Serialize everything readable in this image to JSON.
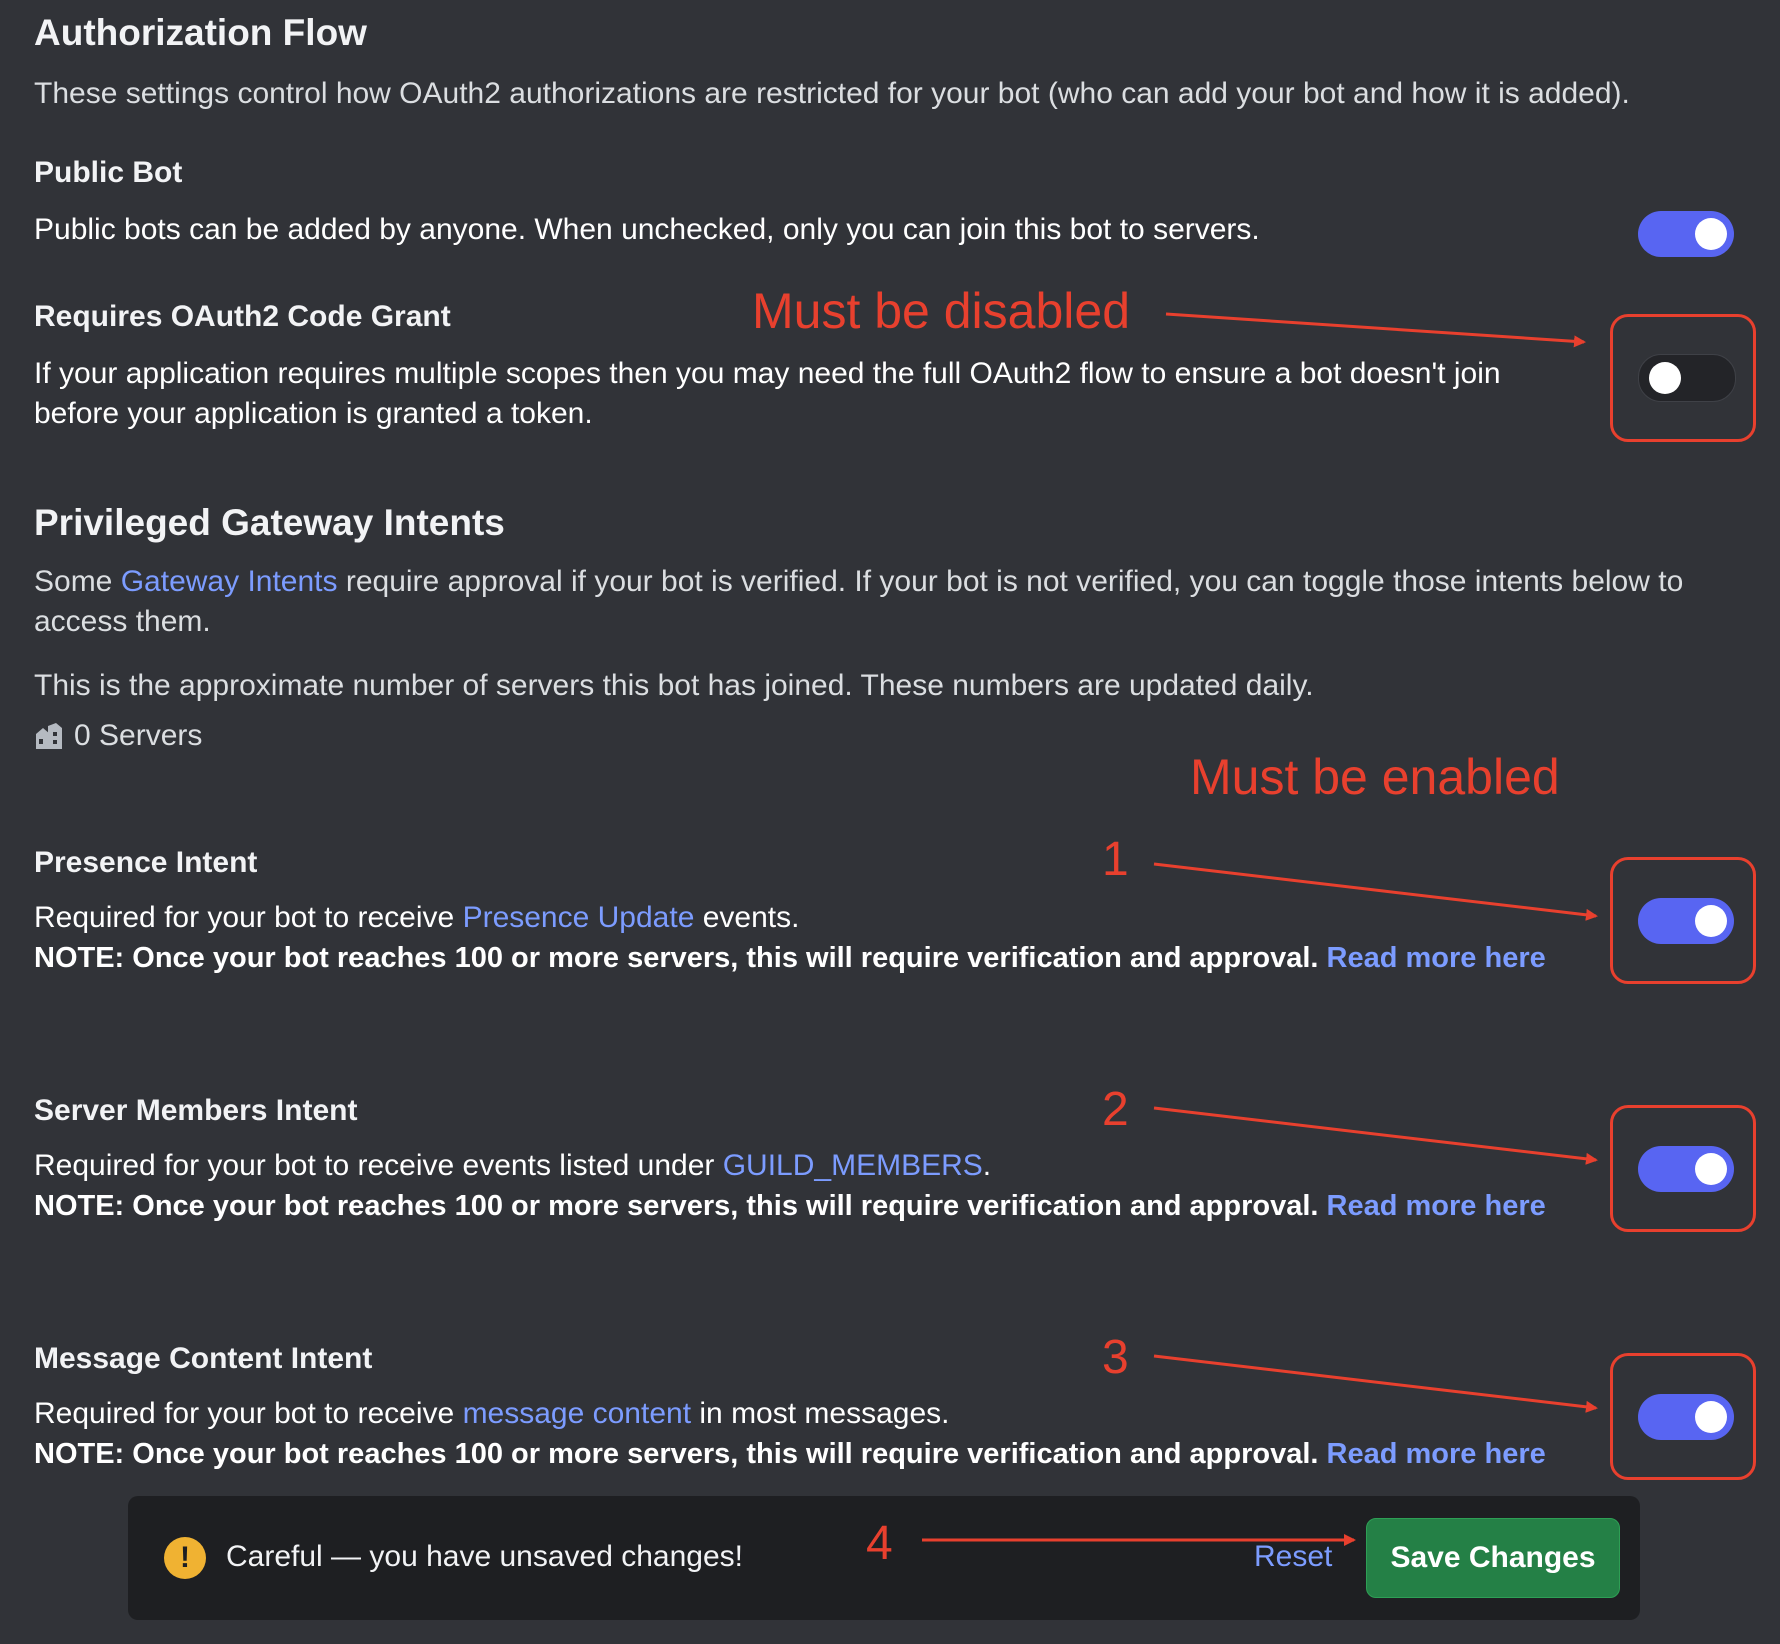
{
  "auth_flow": {
    "title": "Authorization Flow",
    "description": "These settings control how OAuth2 authorizations are restricted for your bot (who can add your bot and how it is added)."
  },
  "public_bot": {
    "label": "Public Bot",
    "description": "Public bots can be added by anyone. When unchecked, only you can join this bot to servers.",
    "enabled": true
  },
  "code_grant": {
    "label": "Requires OAuth2 Code Grant",
    "description_line1": "If your application requires multiple scopes then you may need the full OAuth2 flow to ensure a bot doesn't join",
    "description_line2": "before your application is granted a token.",
    "enabled": false
  },
  "intents": {
    "title": "Privileged Gateway Intents",
    "desc_prefix": "Some ",
    "desc_link": "Gateway Intents",
    "desc_suffix": " require approval if your bot is verified. If your bot is not verified, you can toggle those intents below to",
    "desc_line2": "access them.",
    "servers_note": "This is the approximate number of servers this bot has joined. These numbers are updated daily.",
    "servers_count": "0 Servers",
    "servers_icon": "building-icon"
  },
  "presence": {
    "label": "Presence Intent",
    "text_prefix": "Required for your bot to receive ",
    "text_link": "Presence Update",
    "text_suffix": " events.",
    "note": "NOTE: Once your bot reaches 100 or more servers, this will require verification and approval. ",
    "note_link": "Read more here",
    "enabled": true
  },
  "members": {
    "label": "Server Members Intent",
    "text_prefix": "Required for your bot to receive events listed under ",
    "text_link": "GUILD_MEMBERS",
    "text_suffix": ".",
    "note": "NOTE: Once your bot reaches 100 or more servers, this will require verification and approval. ",
    "note_link": "Read more here",
    "enabled": true
  },
  "message_content": {
    "label": "Message Content Intent",
    "text_prefix": "Required for your bot to receive ",
    "text_link": "message content",
    "text_suffix": " in most messages.",
    "note": "NOTE: Once your bot reaches 100 or more servers, this will require verification and approval. ",
    "note_link": "Read more here",
    "enabled": true
  },
  "annotations": {
    "must_disabled": "Must be disabled",
    "must_enabled": "Must be enabled",
    "n1": "1",
    "n2": "2",
    "n3": "3",
    "n4": "4",
    "color": "#e8402e"
  },
  "save_bar": {
    "warning_icon_glyph": "!",
    "message": "Careful — you have unsaved changes!",
    "reset_label": "Reset",
    "save_label": "Save Changes"
  },
  "colors": {
    "background": "#313338",
    "toggle_on": "#5865f2",
    "link": "#7c9cff",
    "save_button": "#248046",
    "warning": "#f0b232"
  }
}
